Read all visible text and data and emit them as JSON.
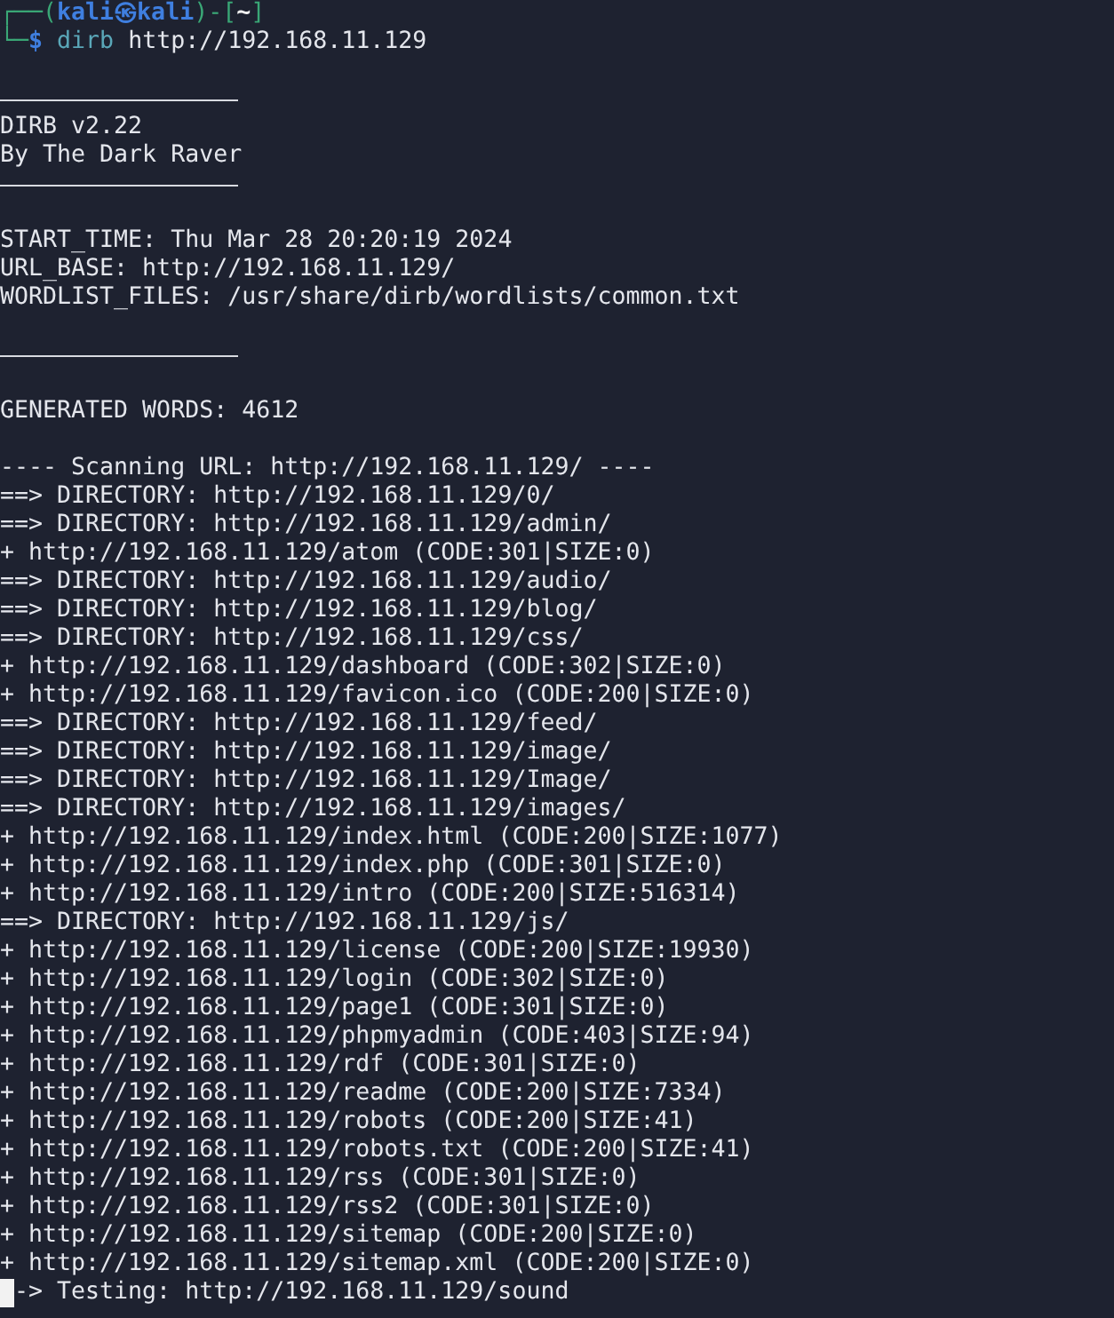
{
  "terminal": {
    "lines": [
      {
        "kind": "prompt",
        "segments": [
          {
            "kind": "frame",
            "text": "┌──("
          },
          {
            "kind": "user",
            "text": "kali㉿kali"
          },
          {
            "kind": "frame",
            "text": ")-["
          },
          {
            "kind": "path",
            "text": "~"
          },
          {
            "kind": "frame",
            "text": "]"
          }
        ]
      },
      {
        "kind": "prompt",
        "segments": [
          {
            "kind": "frame",
            "text": "└─"
          },
          {
            "kind": "user",
            "text": "$"
          },
          {
            "kind": "program",
            "text": "dirb"
          },
          {
            "kind": "plain",
            "text": " http://192.168.11.129"
          }
        ]
      },
      {
        "kind": "blank"
      },
      {
        "kind": "rule"
      },
      {
        "kind": "text",
        "text": "DIRB v2.22"
      },
      {
        "kind": "text",
        "text": "By The Dark Raver"
      },
      {
        "kind": "rule"
      },
      {
        "kind": "blank"
      },
      {
        "kind": "text",
        "text": "START_TIME: Thu Mar 28 20:20:19 2024"
      },
      {
        "kind": "text",
        "text": "URL_BASE: http://192.168.11.129/"
      },
      {
        "kind": "text",
        "text": "WORDLIST_FILES: /usr/share/dirb/wordlists/common.txt"
      },
      {
        "kind": "blank"
      },
      {
        "kind": "rule"
      },
      {
        "kind": "blank"
      },
      {
        "kind": "text",
        "text": "GENERATED WORDS: 4612"
      },
      {
        "kind": "blank"
      },
      {
        "kind": "text",
        "text": "---- Scanning URL: http://192.168.11.129/ ----"
      },
      {
        "kind": "text",
        "text": "==> DIRECTORY: http://192.168.11.129/0/"
      },
      {
        "kind": "text",
        "text": "==> DIRECTORY: http://192.168.11.129/admin/"
      },
      {
        "kind": "text",
        "text": "+ http://192.168.11.129/atom (CODE:301|SIZE:0)"
      },
      {
        "kind": "text",
        "text": "==> DIRECTORY: http://192.168.11.129/audio/"
      },
      {
        "kind": "text",
        "text": "==> DIRECTORY: http://192.168.11.129/blog/"
      },
      {
        "kind": "text",
        "text": "==> DIRECTORY: http://192.168.11.129/css/"
      },
      {
        "kind": "text",
        "text": "+ http://192.168.11.129/dashboard (CODE:302|SIZE:0)"
      },
      {
        "kind": "text",
        "text": "+ http://192.168.11.129/favicon.ico (CODE:200|SIZE:0)"
      },
      {
        "kind": "text",
        "text": "==> DIRECTORY: http://192.168.11.129/feed/"
      },
      {
        "kind": "text",
        "text": "==> DIRECTORY: http://192.168.11.129/image/"
      },
      {
        "kind": "text",
        "text": "==> DIRECTORY: http://192.168.11.129/Image/"
      },
      {
        "kind": "text",
        "text": "==> DIRECTORY: http://192.168.11.129/images/"
      },
      {
        "kind": "text",
        "text": "+ http://192.168.11.129/index.html (CODE:200|SIZE:1077)"
      },
      {
        "kind": "text",
        "text": "+ http://192.168.11.129/index.php (CODE:301|SIZE:0)"
      },
      {
        "kind": "text",
        "text": "+ http://192.168.11.129/intro (CODE:200|SIZE:516314)"
      },
      {
        "kind": "text",
        "text": "==> DIRECTORY: http://192.168.11.129/js/"
      },
      {
        "kind": "text",
        "text": "+ http://192.168.11.129/license (CODE:200|SIZE:19930)"
      },
      {
        "kind": "text",
        "text": "+ http://192.168.11.129/login (CODE:302|SIZE:0)"
      },
      {
        "kind": "text",
        "text": "+ http://192.168.11.129/page1 (CODE:301|SIZE:0)"
      },
      {
        "kind": "text",
        "text": "+ http://192.168.11.129/phpmyadmin (CODE:403|SIZE:94)"
      },
      {
        "kind": "text",
        "text": "+ http://192.168.11.129/rdf (CODE:301|SIZE:0)"
      },
      {
        "kind": "text",
        "text": "+ http://192.168.11.129/readme (CODE:200|SIZE:7334)"
      },
      {
        "kind": "text",
        "text": "+ http://192.168.11.129/robots (CODE:200|SIZE:41)"
      },
      {
        "kind": "text",
        "text": "+ http://192.168.11.129/robots.txt (CODE:200|SIZE:41)"
      },
      {
        "kind": "text",
        "text": "+ http://192.168.11.129/rss (CODE:301|SIZE:0)"
      },
      {
        "kind": "text",
        "text": "+ http://192.168.11.129/rss2 (CODE:301|SIZE:0)"
      },
      {
        "kind": "text",
        "text": "+ http://192.168.11.129/sitemap (CODE:200|SIZE:0)"
      },
      {
        "kind": "text",
        "text": "+ http://192.168.11.129/sitemap.xml (CODE:200|SIZE:0)"
      },
      {
        "kind": "progress",
        "cursor": true,
        "text": "-> Testing: http://192.168.11.129/sound"
      }
    ]
  }
}
